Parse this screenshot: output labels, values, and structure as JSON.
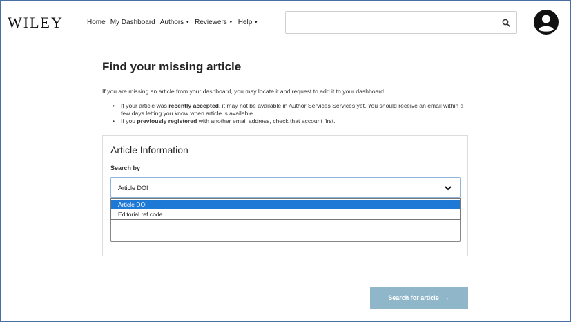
{
  "header": {
    "logo": "WILEY",
    "nav": [
      {
        "label": "Home",
        "has_menu": false
      },
      {
        "label": "My Dashboard",
        "has_menu": false
      },
      {
        "label": "Authors",
        "has_menu": true
      },
      {
        "label": "Reviewers",
        "has_menu": true
      },
      {
        "label": "Help",
        "has_menu": true
      }
    ],
    "search": {
      "value": "",
      "placeholder": "",
      "icon": "search-icon"
    },
    "avatar_icon": "user-avatar-icon"
  },
  "main": {
    "title": "Find your missing article",
    "intro": "If you are missing an article from your dashboard, you may locate it and request to add it to your dashboard.",
    "bullets": [
      {
        "before": "If your article was ",
        "bold": "recently accepted",
        "after": ", it may not be available in Author Services Services yet. You should receive an email within a few days letting you know when article is available."
      },
      {
        "before": "If you ",
        "bold": "previously registered",
        "after": " with another email address, check that account first."
      }
    ],
    "card": {
      "title": "Article Information",
      "search_by_label": "Search by",
      "selected": "Article DOI",
      "options": [
        "Article DOI",
        "Editorial ref code"
      ],
      "field_value": ""
    },
    "submit_label": "Search for article",
    "submit_arrow": "→"
  },
  "colors": {
    "border_frame": "#4a6fa5",
    "dropdown_highlight": "#1e78d6",
    "button_bg": "#8fb7c9"
  }
}
